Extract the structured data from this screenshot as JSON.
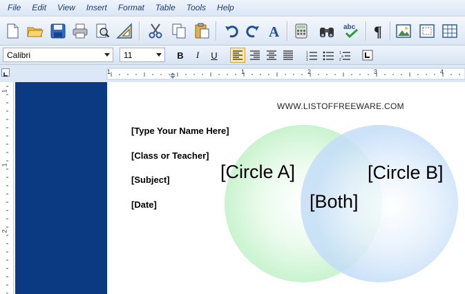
{
  "menu": [
    "File",
    "Edit",
    "View",
    "Insert",
    "Format",
    "Table",
    "Tools",
    "Help"
  ],
  "toolbar": {
    "buttons": [
      "new-document-icon",
      "open-folder-icon",
      "save-icon",
      "print-icon",
      "print-preview-icon",
      "ruler-tool-icon",
      "cut-icon",
      "copy-icon",
      "paste-icon",
      "undo-icon",
      "redo-icon",
      "font-style-icon",
      "calculator-icon",
      "find-binoculars-icon",
      "spell-check-icon",
      "paragraph-marks-icon",
      "insert-picture-icon",
      "frame-icon",
      "insert-table-icon"
    ],
    "spell_label": "abc"
  },
  "format_bar": {
    "font_name": "Calibri",
    "font_size": "11",
    "bold_label": "B",
    "italic_label": "I",
    "underline_label": "U",
    "active_alignment": "left"
  },
  "ruler": {
    "h_numbers": [
      "1",
      "1",
      "2",
      "3",
      "4"
    ],
    "v_numbers": [
      "1",
      "1",
      "2"
    ]
  },
  "document": {
    "website": "WWW.LISTOFFREEWARE.COM",
    "fields": [
      "[Type Your Name Here]",
      "[Class or Teacher]",
      "[Subject]",
      "[Date]"
    ],
    "circle_a": "[Circle A]",
    "circle_b": "[Circle B]",
    "both": "[Both]",
    "colors": {
      "sidebar": "#0b3a82",
      "circle_a": "#c9f3cf",
      "circle_b": "#c3ddf7"
    }
  }
}
